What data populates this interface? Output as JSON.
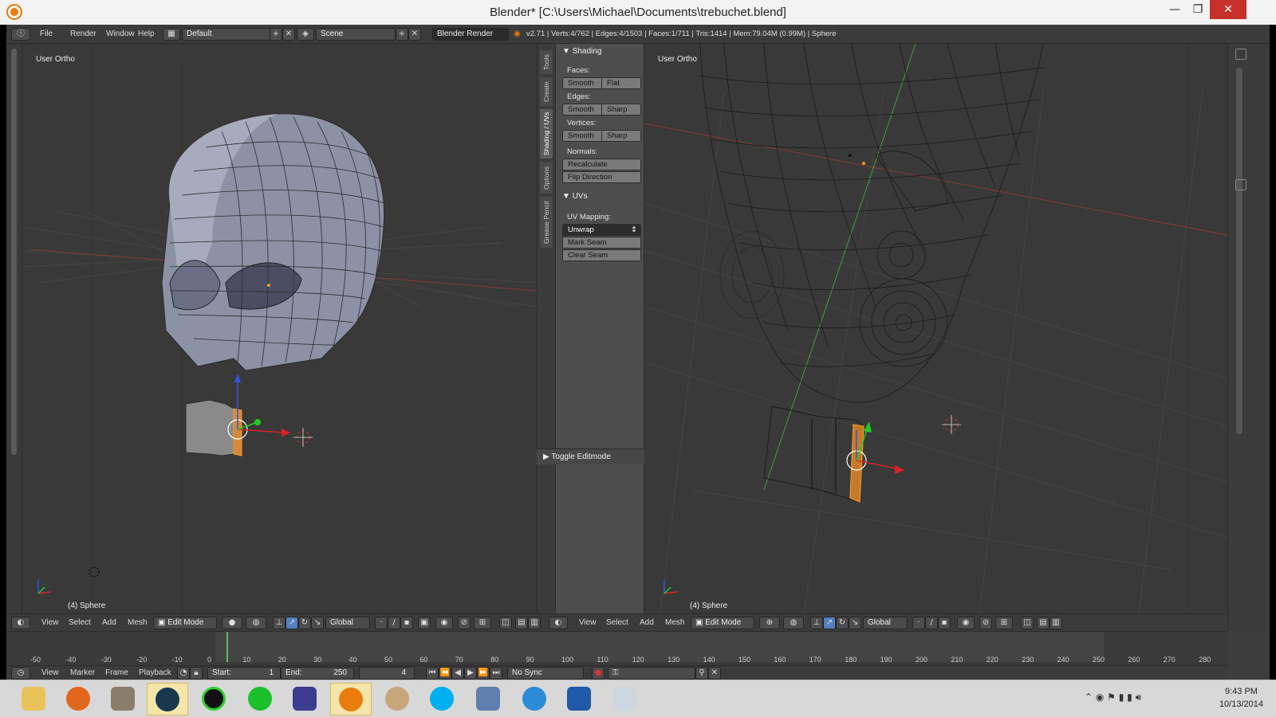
{
  "window": {
    "title": "Blender* [C:\\Users\\Michael\\Documents\\trebuchet.blend]",
    "minimize": "—",
    "maximize": "❐",
    "close": "✕"
  },
  "info": {
    "menu": [
      "File",
      "Render",
      "Window",
      "Help"
    ],
    "screen_layout": "Default",
    "scene": "Scene",
    "render_engine": "Blender Render",
    "stats": "v2.71 | Verts:4/762 | Edges:4/1503 | Faces:1/711 | Tris:1414 | Mem:79.04M (0.99M) | Sphere"
  },
  "viewport_left": {
    "label": "User Ortho",
    "object": "(4) Sphere"
  },
  "viewport_right": {
    "label": "User Ortho",
    "object": "(4) Sphere"
  },
  "tabs": [
    "Tools",
    "Create",
    "Shading / UVs",
    "Options",
    "Grease Pencil"
  ],
  "shading_panel": {
    "title": "Shading",
    "faces_label": "Faces:",
    "faces_smooth": "Smooth",
    "faces_flat": "Flat",
    "edges_label": "Edges:",
    "edges_smooth": "Smooth",
    "edges_sharp": "Sharp",
    "vertices_label": "Vertices:",
    "vertices_smooth": "Smooth",
    "vertices_sharp": "Sharp",
    "normals_label": "Normals:",
    "recalculate": "Recalculate",
    "flip_direction": "Flip Direction"
  },
  "uvs_panel": {
    "title": "UVs",
    "mapping_label": "UV Mapping:",
    "unwrap": "Unwrap",
    "mark_seam": "Mark Seam",
    "clear_seam": "Clear Seam"
  },
  "toggle_editmode": "Toggle Editmode",
  "header_left": {
    "menu": [
      "View",
      "Select",
      "Add",
      "Mesh"
    ],
    "mode": "Edit Mode",
    "orientation": "Global"
  },
  "header_right": {
    "menu": [
      "View",
      "Select",
      "Add",
      "Mesh"
    ],
    "mode": "Edit Mode",
    "orientation": "Global"
  },
  "timeline": {
    "ticks": [
      "-50",
      "-40",
      "-30",
      "-20",
      "-10",
      "0",
      "10",
      "20",
      "30",
      "40",
      "50",
      "60",
      "70",
      "80",
      "90",
      "100",
      "110",
      "120",
      "130",
      "140",
      "150",
      "160",
      "170",
      "180",
      "190",
      "200",
      "210",
      "220",
      "230",
      "240",
      "250",
      "260",
      "270",
      "280"
    ],
    "menu": [
      "View",
      "Marker",
      "Frame",
      "Playback"
    ],
    "start_label": "Start:",
    "start_value": "1",
    "end_label": "End:",
    "end_value": "250",
    "current_frame": "4",
    "sync": "No Sync"
  },
  "taskbar": {
    "apps": [
      "file-explorer",
      "firefox",
      "gimp",
      "steam",
      "razer",
      "cloud",
      "visual-studio",
      "blender",
      "paint",
      "skype",
      "remote-desktop",
      "skype-business",
      "pen-tool",
      "photo-viewer"
    ],
    "time": "9:43 PM",
    "date": "10/13/2014"
  },
  "colors": {
    "axis_x": "#b63a3a",
    "axis_y": "#3fa03f",
    "mesh_face": "#9aa0b8",
    "selection": "#f09a29",
    "grid": "#4a4a4a"
  }
}
